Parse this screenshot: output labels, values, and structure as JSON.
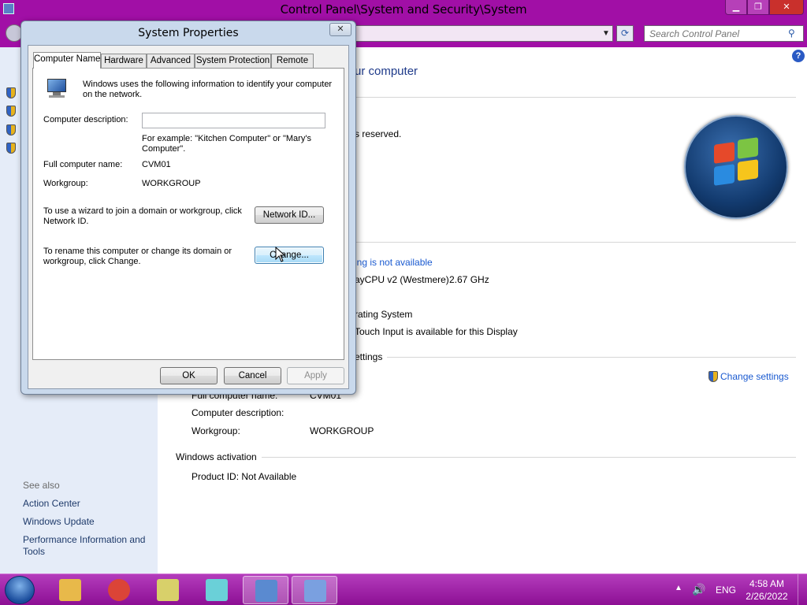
{
  "control_panel": {
    "title": "Control Panel\\System and Security\\System",
    "search_placeholder": "Search Control Panel",
    "main": {
      "heading_fragment": "ur computer",
      "copyright_fragment": "s reserved.",
      "rating_fragment": "ing is not available",
      "processor_fragment": "ayCPU v2 (Westmere)",
      "processor_speed": "2.67 GHz",
      "system_type_fragment": "rating System",
      "pen_touch_fragment": "Touch Input is available for this Display",
      "computer_settings_fragment": "ettings",
      "change_settings": "Change settings",
      "full_name_label_fragment": "Full computer name:",
      "full_name_value_fragment": "CVM01",
      "computer_description_label": "Computer description:",
      "workgroup_label": "Workgroup:",
      "workgroup_value": "WORKGROUP",
      "windows_activation": "Windows activation",
      "product_id": "Product ID:  Not Available"
    },
    "see_also": {
      "heading": "See also",
      "links": [
        "Action Center",
        "Windows Update",
        "Performance Information and Tools"
      ]
    }
  },
  "system_properties": {
    "title": "System Properties",
    "close_glyph": "✕",
    "tabs": [
      "Computer Name",
      "Hardware",
      "Advanced",
      "System Protection",
      "Remote"
    ],
    "active_tab": "Computer Name",
    "intro": "Windows uses the following information to identify your computer on the network.",
    "description_label": "Computer description:",
    "description_value": "",
    "description_example": "For example: \"Kitchen Computer\" or \"Mary's Computer\".",
    "full_name_label": "Full computer name:",
    "full_name_value": "CVM01",
    "workgroup_label": "Workgroup:",
    "workgroup_value": "WORKGROUP",
    "network_id_text": "To use a wizard to join a domain or workgroup, click Network ID.",
    "network_id_button": "Network ID...",
    "rename_text": "To rename this computer or change its domain or workgroup, click Change.",
    "change_button": "Change...",
    "ok_button": "OK",
    "cancel_button": "Cancel",
    "apply_button": "Apply"
  },
  "taskbar": {
    "language": "ENG",
    "time": "4:58 AM",
    "date": "2/26/2022",
    "pinned": [
      {
        "name": "explorer",
        "color": "#e8b94a"
      },
      {
        "name": "chrome",
        "color": "#db4437"
      },
      {
        "name": "folder-sync",
        "color": "#d8d06a"
      },
      {
        "name": "installer",
        "color": "#6ad0d8"
      },
      {
        "name": "control-panel",
        "color": "#5a8ad0",
        "active": true
      },
      {
        "name": "system-properties",
        "color": "#7aa0e0",
        "active": true
      }
    ]
  },
  "colors": {
    "titlebar": "#a10fa6",
    "taskbar": "#9a1aa0",
    "link": "#1a5ad0",
    "dialog_frame": "#c9d9ec"
  }
}
